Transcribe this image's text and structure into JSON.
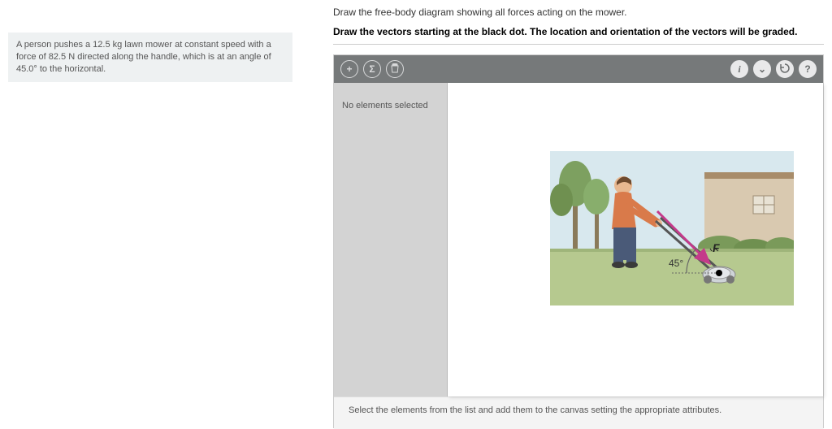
{
  "problem": {
    "text_pre": "A person pushes a 12.5 ",
    "unit1": "kg",
    "text_mid1": " lawn mower at constant speed with a force of 82.5 ",
    "unit2": "N",
    "text_mid2": " directed along the handle, which is at an angle of 45.0° to the horizontal."
  },
  "instructions": {
    "main": "Draw the free-body diagram showing all forces acting on the mower.",
    "bold": "Draw the vectors starting at the black dot. The location and orientation of the vectors will be graded."
  },
  "toolbar": {
    "add": "+",
    "sum": "Σ",
    "delete": "🗑",
    "info": "i",
    "dropdown": "⌄",
    "reset": "↻",
    "help": "?"
  },
  "sidepanel": {
    "status": "No elements selected"
  },
  "illustration": {
    "force_label": "F",
    "angle_label": "45°"
  },
  "hint": "Select the elements from the list and add them to the canvas setting the appropriate attributes."
}
